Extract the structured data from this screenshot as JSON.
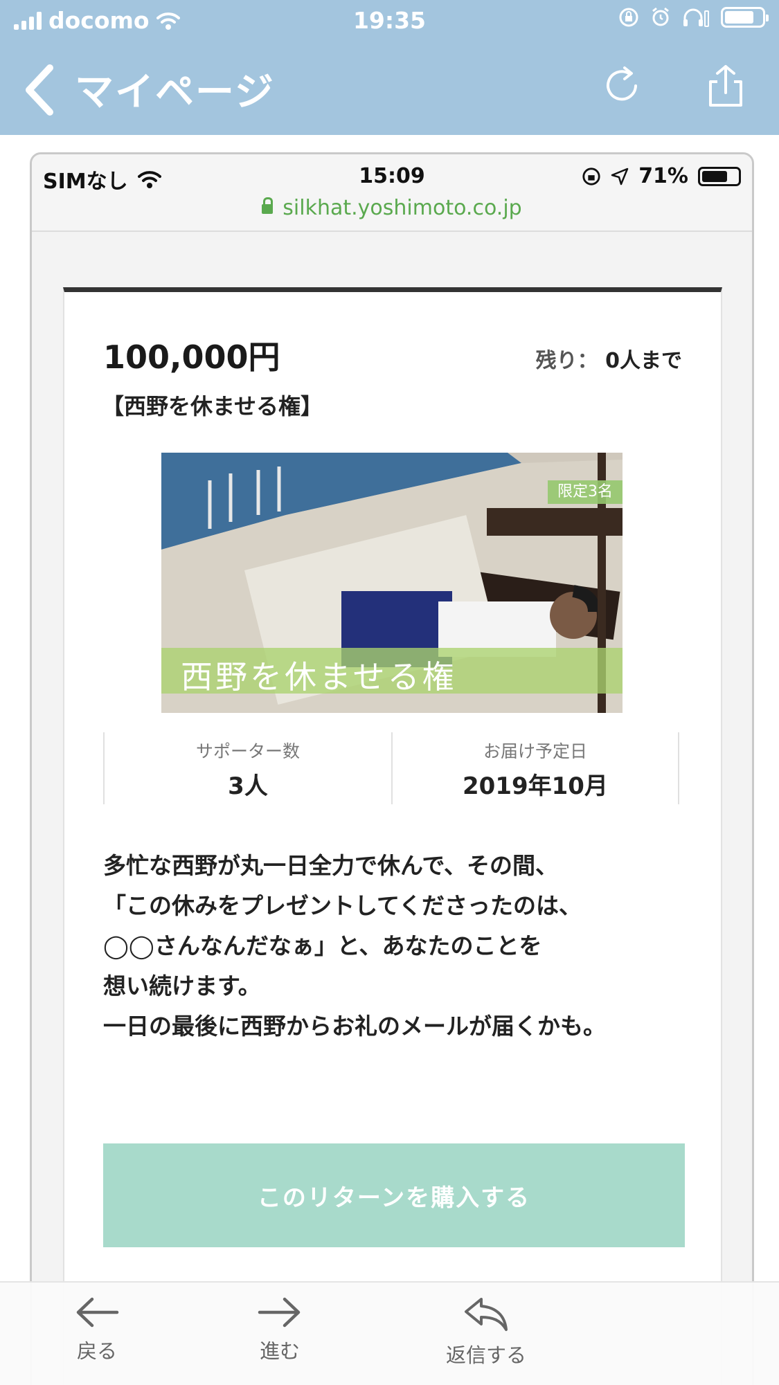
{
  "outer_status": {
    "carrier": "docomo",
    "time": "19:35"
  },
  "outer_nav": {
    "title": "マイページ",
    "icons": [
      "chevron-left-icon",
      "reload-icon",
      "share-icon"
    ]
  },
  "inner_status": {
    "carrier": "SIMなし",
    "time": "15:09",
    "battery": "71%"
  },
  "url": "silkhat.yoshimoto.co.jp",
  "card": {
    "price": "100,000円",
    "remain_label": "残り：",
    "remain_value": "0人まで",
    "title": "【西野を休ませる権】",
    "image_badge": "限定3名",
    "image_caption": "西野を休ませる権",
    "stats": [
      {
        "label": "サポーター数",
        "value": "3人"
      },
      {
        "label": "お届け予定日",
        "value": "2019年10月"
      }
    ],
    "description": [
      "多忙な西野が丸一日全力で休んで、その間、",
      "「この休みをプレゼントしてくださったのは、",
      "◯◯さんなんだなぁ」と、あなたのことを",
      "想い続けます。",
      "一日の最後に西野からお礼のメールが届くかも。"
    ],
    "buy_button": "このリターンを購入する"
  },
  "toolbar": {
    "back": "戻る",
    "forward": "進む",
    "reply": "返信する"
  },
  "colors": {
    "header_bg": "#a3c5de",
    "url_green": "#5aa94e",
    "buy_button": "#a8dacb",
    "card_top_border": "#333333"
  }
}
